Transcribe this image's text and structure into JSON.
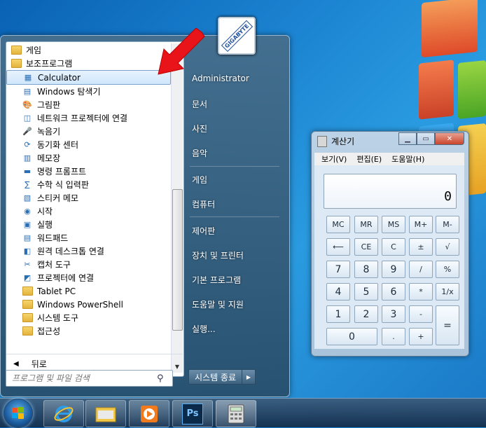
{
  "start_menu": {
    "programs": [
      {
        "label": "게임",
        "icon": "folder-icon",
        "selected": false
      },
      {
        "label": "보조프로그램",
        "icon": "folder-icon",
        "selected": false
      },
      {
        "label": "Calculator",
        "icon": "calculator-icon",
        "selected": true
      },
      {
        "label": "Windows 탐색기",
        "icon": "explorer-icon",
        "selected": false
      },
      {
        "label": "그림판",
        "icon": "paint-icon",
        "selected": false
      },
      {
        "label": "네트워크 프로젝터에 연결",
        "icon": "network-projector-icon",
        "selected": false
      },
      {
        "label": "녹음기",
        "icon": "microphone-icon",
        "selected": false
      },
      {
        "label": "동기화 센터",
        "icon": "sync-icon",
        "selected": false
      },
      {
        "label": "메모장",
        "icon": "notepad-icon",
        "selected": false
      },
      {
        "label": "명령 프롬프트",
        "icon": "cmd-icon",
        "selected": false
      },
      {
        "label": "수학 식 입력판",
        "icon": "math-input-icon",
        "selected": false
      },
      {
        "label": "스티커 메모",
        "icon": "sticky-notes-icon",
        "selected": false
      },
      {
        "label": "시작",
        "icon": "getting-started-icon",
        "selected": false
      },
      {
        "label": "실행",
        "icon": "run-icon",
        "selected": false
      },
      {
        "label": "워드패드",
        "icon": "wordpad-icon",
        "selected": false
      },
      {
        "label": "원격 데스크톱 연결",
        "icon": "remote-desktop-icon",
        "selected": false
      },
      {
        "label": "캡처 도구",
        "icon": "snipping-tool-icon",
        "selected": false
      },
      {
        "label": "프로젝터에 연결",
        "icon": "projector-icon",
        "selected": false
      },
      {
        "label": "Tablet PC",
        "icon": "folder-icon",
        "selected": false
      },
      {
        "label": "Windows PowerShell",
        "icon": "folder-icon",
        "selected": false
      },
      {
        "label": "시스템 도구",
        "icon": "folder-icon",
        "selected": false
      },
      {
        "label": "접근성",
        "icon": "folder-icon",
        "selected": false
      }
    ],
    "back_label": "뒤로",
    "search_placeholder": "프로그램 및 파일 검색",
    "right_items": [
      "Administrator",
      "문서",
      "사진",
      "음악",
      "게임",
      "컴퓨터",
      "제어판",
      "장치 및 프린터",
      "기본 프로그램",
      "도움말 및 지원",
      "실행..."
    ],
    "shutdown_label": "시스템 종료",
    "avatar_text": "GIGABYTE"
  },
  "calculator": {
    "title": "계산기",
    "menu": [
      "보기(V)",
      "편집(E)",
      "도움말(H)"
    ],
    "display": "0",
    "rows": [
      [
        "MC",
        "MR",
        "MS",
        "M+",
        "M-"
      ],
      [
        "⟵",
        "CE",
        "C",
        "±",
        "√"
      ],
      [
        "7",
        "8",
        "9",
        "/",
        "%"
      ],
      [
        "4",
        "5",
        "6",
        "*",
        "1/x"
      ],
      [
        "1",
        "2",
        "3",
        "-",
        "="
      ],
      [
        "0",
        ".",
        "+"
      ]
    ]
  },
  "taskbar": {
    "items": [
      "internet-explorer-icon",
      "file-explorer-icon",
      "media-player-icon",
      "photoshop-icon",
      "calculator-icon"
    ],
    "photoshop_label": "Ps"
  },
  "colors": {
    "accent_arrow": "#e8141a",
    "desktop_blue": "#1b83d1"
  }
}
